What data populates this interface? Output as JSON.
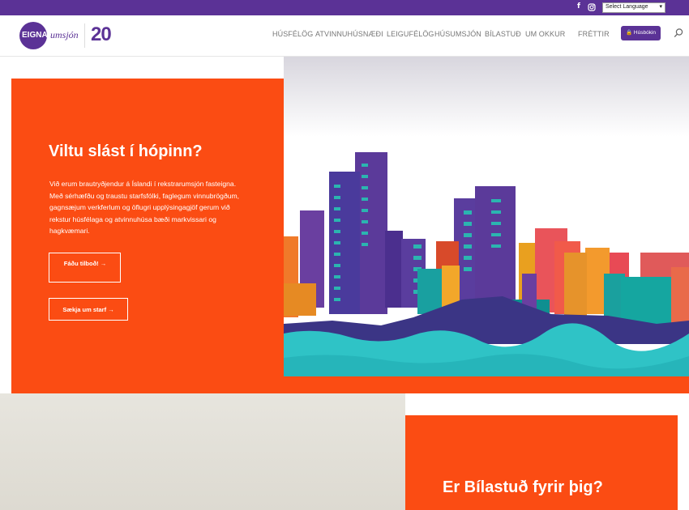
{
  "topbar": {
    "facebook_icon": "f",
    "instagram_icon": "instagram-icon",
    "language_select": "Select Language"
  },
  "header": {
    "logo_main": "EIGNA",
    "logo_script": "umsjón",
    "anniversary": "20",
    "nav": [
      "HÚSFÉLÖG",
      "ATVINNUHÚSNÆÐI",
      "LEIGUFÉLÖG",
      "HÚSUMSJÓN",
      "BÍLASTUÐ",
      "UM OKKUR",
      "FRÉTTIR"
    ],
    "login_label": "Húsbókin"
  },
  "hero": {
    "title": "Viltu slást í hópinn?",
    "body": "Við erum brautryðjendur á Íslandi í rekstrarumsjón fasteigna. Með sérhæfðu og traustu starfsfólki, faglegum vinnubrögðum, gagnsæjum verkferlum og öflugri upplýsingagjöf gerum við rekstur húsfélaga og atvinnuhúsa bæði markvissari og hagkvæmari.",
    "cta_quote": "Fáðu tilboð!",
    "cta_job": "Sækja um starf"
  },
  "bilastud": {
    "title": "Er Bílastuð fyrir þig?"
  },
  "colors": {
    "brand_purple": "#5b3296",
    "accent_orange": "#fb4c13"
  }
}
